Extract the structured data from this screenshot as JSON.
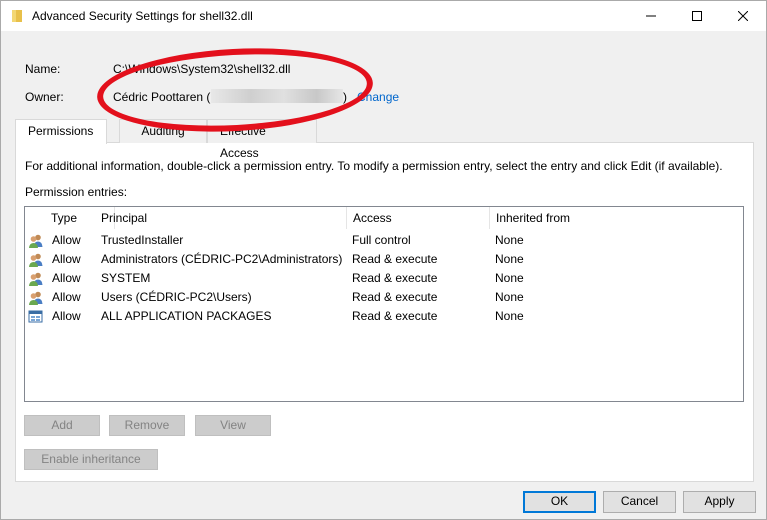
{
  "window": {
    "title": "Advanced Security Settings for shell32.dll"
  },
  "info": {
    "name_label": "Name:",
    "name_value": "C:\\Windows\\System32\\shell32.dll",
    "owner_label": "Owner:",
    "owner_value_prefix": "Cédric Poottaren (",
    "owner_value_suffix": ")",
    "change_link": "Change"
  },
  "tabs": [
    {
      "label": "Permissions",
      "active": true
    },
    {
      "label": "Auditing",
      "active": false
    },
    {
      "label": "Effective Access",
      "active": false
    }
  ],
  "permissions": {
    "info_text": "For additional information, double-click a permission entry. To modify a permission entry, select the entry and click Edit (if available).",
    "entries_label": "Permission entries:",
    "columns": [
      "Type",
      "Principal",
      "Access",
      "Inherited from"
    ],
    "rows": [
      {
        "icon": "user-group-icon",
        "type": "Allow",
        "principal": "TrustedInstaller",
        "access": "Full control",
        "inherited": "None"
      },
      {
        "icon": "user-group-icon",
        "type": "Allow",
        "principal": "Administrators (CÉDRIC-PC2\\Administrators)",
        "access": "Read & execute",
        "inherited": "None"
      },
      {
        "icon": "user-group-icon",
        "type": "Allow",
        "principal": "SYSTEM",
        "access": "Read & execute",
        "inherited": "None"
      },
      {
        "icon": "user-group-icon",
        "type": "Allow",
        "principal": "Users (CÉDRIC-PC2\\Users)",
        "access": "Read & execute",
        "inherited": "None"
      },
      {
        "icon": "app-packages-icon",
        "type": "Allow",
        "principal": "ALL APPLICATION PACKAGES",
        "access": "Read & execute",
        "inherited": "None"
      }
    ]
  },
  "buttons": {
    "add": "Add",
    "remove": "Remove",
    "view": "View",
    "enable_inheritance": "Enable inheritance",
    "ok": "OK",
    "cancel": "Cancel",
    "apply": "Apply"
  },
  "colors": {
    "link": "#0066cc",
    "annotation": "#e3101c",
    "focus": "#0078d7"
  }
}
